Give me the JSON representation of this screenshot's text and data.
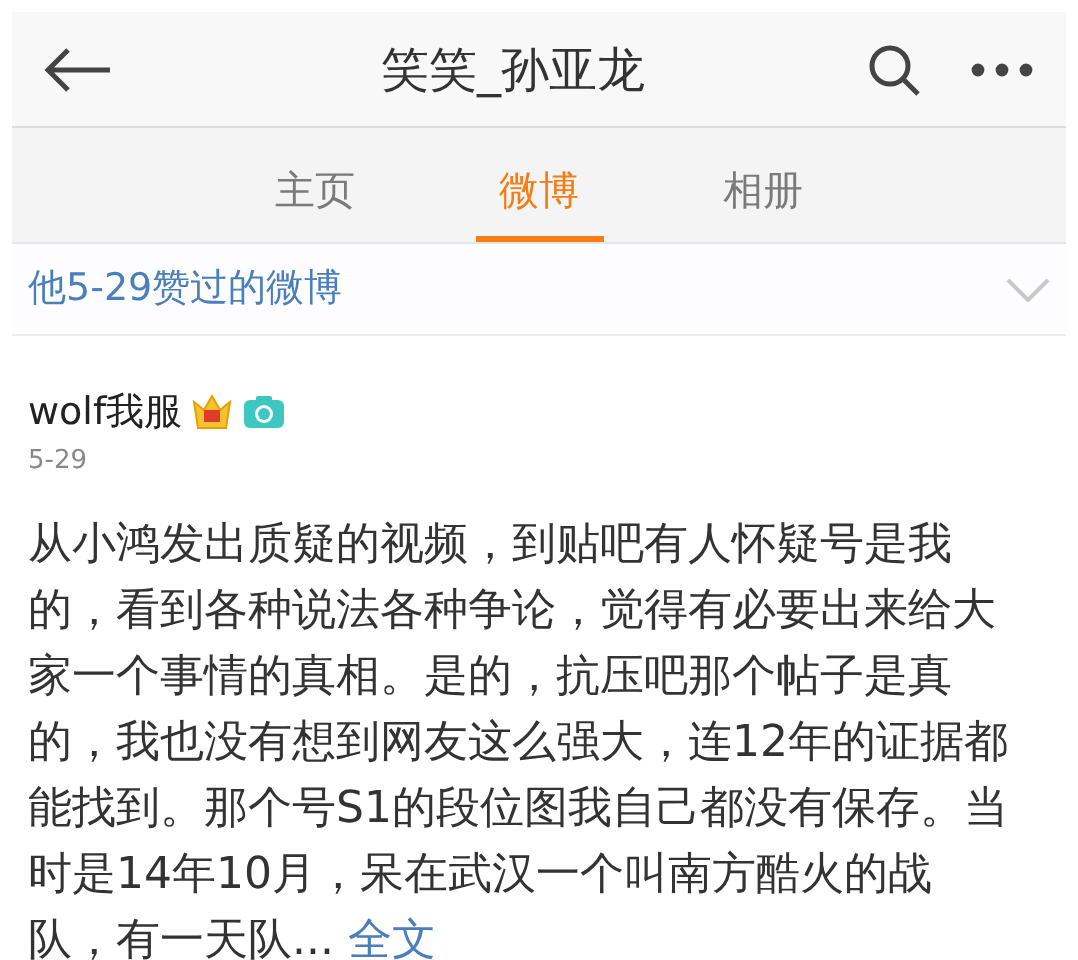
{
  "header": {
    "title": "笑笑_孙亚龙"
  },
  "tabs": [
    {
      "label": "主页",
      "selected": false
    },
    {
      "label": "微博",
      "selected": true
    },
    {
      "label": "相册",
      "selected": false
    }
  ],
  "filter": {
    "label": "他5-29赞过的微博",
    "expanded": false
  },
  "post": {
    "author": "wolf我服",
    "date": "5-29",
    "text": "从小鸿发出质疑的视频，到贴吧有人怀疑号是我的，看到各种说法各种争论，觉得有必要出来给大家一个事情的真相。是的，抗压吧那个帖子是真的，我也没有想到网友这么强大，连12年的证据都能找到。那个号S1的段位图我自己都没有保存。当时是14年10月，呆在武汉一个叫南方酷火的战队，有一天队...",
    "more": "全文"
  }
}
